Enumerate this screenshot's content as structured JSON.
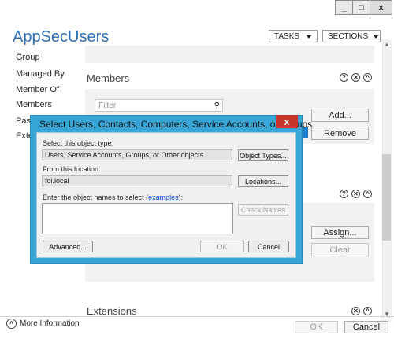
{
  "window": {
    "minimize": "_",
    "maximize": "□",
    "close": "x"
  },
  "app": {
    "title": "AppSecUsers",
    "tasks": "TASKS",
    "sections": "SECTIONS"
  },
  "nav": [
    "Group",
    "Managed By",
    "Member Of",
    "Members",
    "Password",
    "Extensions"
  ],
  "members": {
    "heading": "Members",
    "filter_placeholder": "Filter",
    "add": "Add...",
    "remove": "Remove"
  },
  "member_of": {
    "assign": "Assign...",
    "clear": "Clear"
  },
  "extensions": {
    "heading": "Extensions"
  },
  "footer": {
    "more_info": "More Information",
    "ok": "OK",
    "cancel": "Cancel"
  },
  "dialog": {
    "title": "Select Users, Contacts, Computers, Service Accounts, or Groups",
    "close": "x",
    "type_label": "Select this object type:",
    "type_value": "Users, Service Accounts, Groups, or Other objects",
    "object_types": "Object Types...",
    "location_label": "From this location:",
    "location_value": "foi.local",
    "locations": "Locations...",
    "names_label_prefix": "Enter the object names to select (",
    "names_label_link": "examples",
    "names_label_suffix": "):",
    "names_value": "",
    "check_names": "Check Names",
    "advanced": "Advanced...",
    "ok": "OK",
    "cancel": "Cancel"
  }
}
